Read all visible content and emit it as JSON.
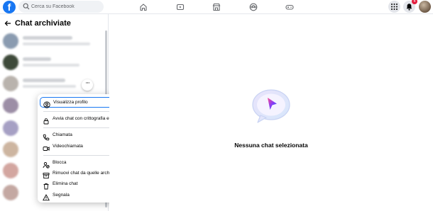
{
  "topbar": {
    "logo": "f",
    "search_placeholder": "Cerca su Facebook",
    "nav_icons": [
      "home-icon",
      "watch-icon",
      "marketplace-icon",
      "groups-icon",
      "gaming-icon"
    ],
    "notification_count": "4",
    "accent": "#1877f2"
  },
  "sidebar": {
    "title": "Chat archiviate"
  },
  "context_menu": {
    "items": [
      {
        "label": "Visualizza profilo",
        "icon": "profile-icon"
      },
      {
        "label": "Avvia chat con crittografia end-to-end",
        "icon": "lock-icon"
      },
      {
        "label": "Chiamata",
        "icon": "phone-icon"
      },
      {
        "label": "Videochiamata",
        "icon": "video-camera-icon"
      },
      {
        "label": "Blocca",
        "icon": "block-user-icon"
      },
      {
        "label": "Rimuovi chat da quelle archiviate",
        "icon": "archive-icon"
      },
      {
        "label": "Elimina chat",
        "icon": "trash-icon"
      },
      {
        "label": "Segnala",
        "icon": "warning-icon"
      }
    ]
  },
  "main": {
    "empty_state_text": "Nessuna chat selezionata"
  }
}
